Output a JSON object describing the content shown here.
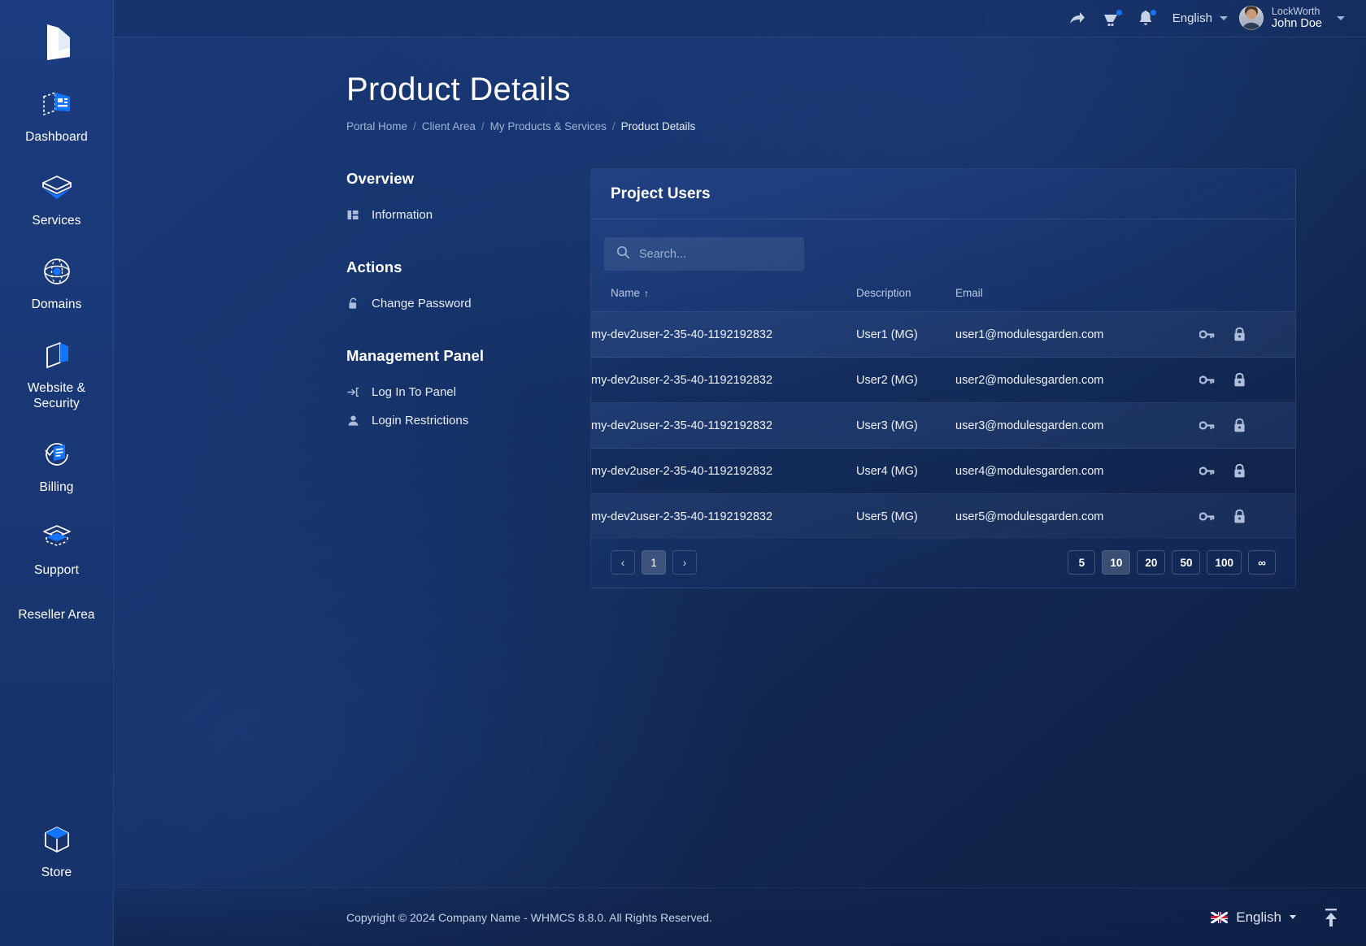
{
  "sidebar": {
    "logo_icon": "lockworth-logo-icon",
    "items": [
      {
        "label": "Dashboard",
        "icon": "dashboard-icon"
      },
      {
        "label": "Services",
        "icon": "services-box-icon"
      },
      {
        "label": "Domains",
        "icon": "domains-globe-icon"
      },
      {
        "label": "Website & Security",
        "icon": "website-security-icon"
      },
      {
        "label": "Billing",
        "icon": "billing-invoice-icon"
      },
      {
        "label": "Support",
        "icon": "support-layers-icon"
      },
      {
        "label": "Reseller Area",
        "icon": ""
      }
    ],
    "bottom_item": {
      "label": "Store",
      "icon": "store-cube-icon"
    }
  },
  "topbar": {
    "share_icon": "share-arrow-icon",
    "cart_icon": "cart-icon",
    "bell_icon": "bell-icon",
    "language": "English",
    "user_company": "LockWorth",
    "user_name": "John Doe"
  },
  "page": {
    "title": "Product Details",
    "breadcrumb": [
      "Portal Home",
      "Client Area",
      "My Products & Services",
      "Product Details"
    ]
  },
  "side_menu": {
    "sections": [
      {
        "title": "Overview",
        "items": [
          {
            "label": "Information",
            "icon": "information-columns-icon"
          }
        ]
      },
      {
        "title": "Actions",
        "items": [
          {
            "label": "Change Password",
            "icon": "unlocked-padlock-icon"
          }
        ]
      },
      {
        "title": "Management Panel",
        "items": [
          {
            "label": "Log In To Panel",
            "icon": "login-arrow-icon"
          },
          {
            "label": "Login Restrictions",
            "icon": "person-icon"
          }
        ]
      }
    ]
  },
  "panel": {
    "title": "Project Users",
    "search_placeholder": "Search...",
    "search_value": "",
    "search_icon": "search-icon",
    "columns": [
      "Name",
      "Description",
      "Email"
    ],
    "sort_column": "Name",
    "sort_direction": "asc",
    "sort_arrow": "↑",
    "rows": [
      {
        "name": "my-dev2user-2-35-40-1192192832",
        "description": "User1 (MG)",
        "email": "user1@modulesgarden.com"
      },
      {
        "name": "my-dev2user-2-35-40-1192192832",
        "description": "User2 (MG)",
        "email": "user2@modulesgarden.com"
      },
      {
        "name": "my-dev2user-2-35-40-1192192832",
        "description": "User3 (MG)",
        "email": "user3@modulesgarden.com"
      },
      {
        "name": "my-dev2user-2-35-40-1192192832",
        "description": "User4 (MG)",
        "email": "user4@modulesgarden.com"
      },
      {
        "name": "my-dev2user-2-35-40-1192192832",
        "description": "User5 (MG)",
        "email": "user5@modulesgarden.com"
      }
    ],
    "row_action_icons": [
      "key-icon",
      "padlock-icon"
    ],
    "pagination": {
      "prev_label": "‹",
      "next_label": "›",
      "pages": [
        "1"
      ],
      "current_page": "1",
      "page_sizes": [
        "5",
        "10",
        "20",
        "50",
        "100",
        "∞"
      ],
      "active_page_size": "10"
    }
  },
  "footer": {
    "copyright": "Copyright © 2024 Company Name - WHMCS 8.8.0. All Rights Reserved.",
    "language": "English",
    "flag_icon": "uk-flag-icon",
    "to_top_icon": "scroll-to-top-icon"
  },
  "colors": {
    "accent": "#1374ff",
    "bg_dark": "#12274f",
    "sidebar": "#1b3c80",
    "text": "#ffffff"
  }
}
